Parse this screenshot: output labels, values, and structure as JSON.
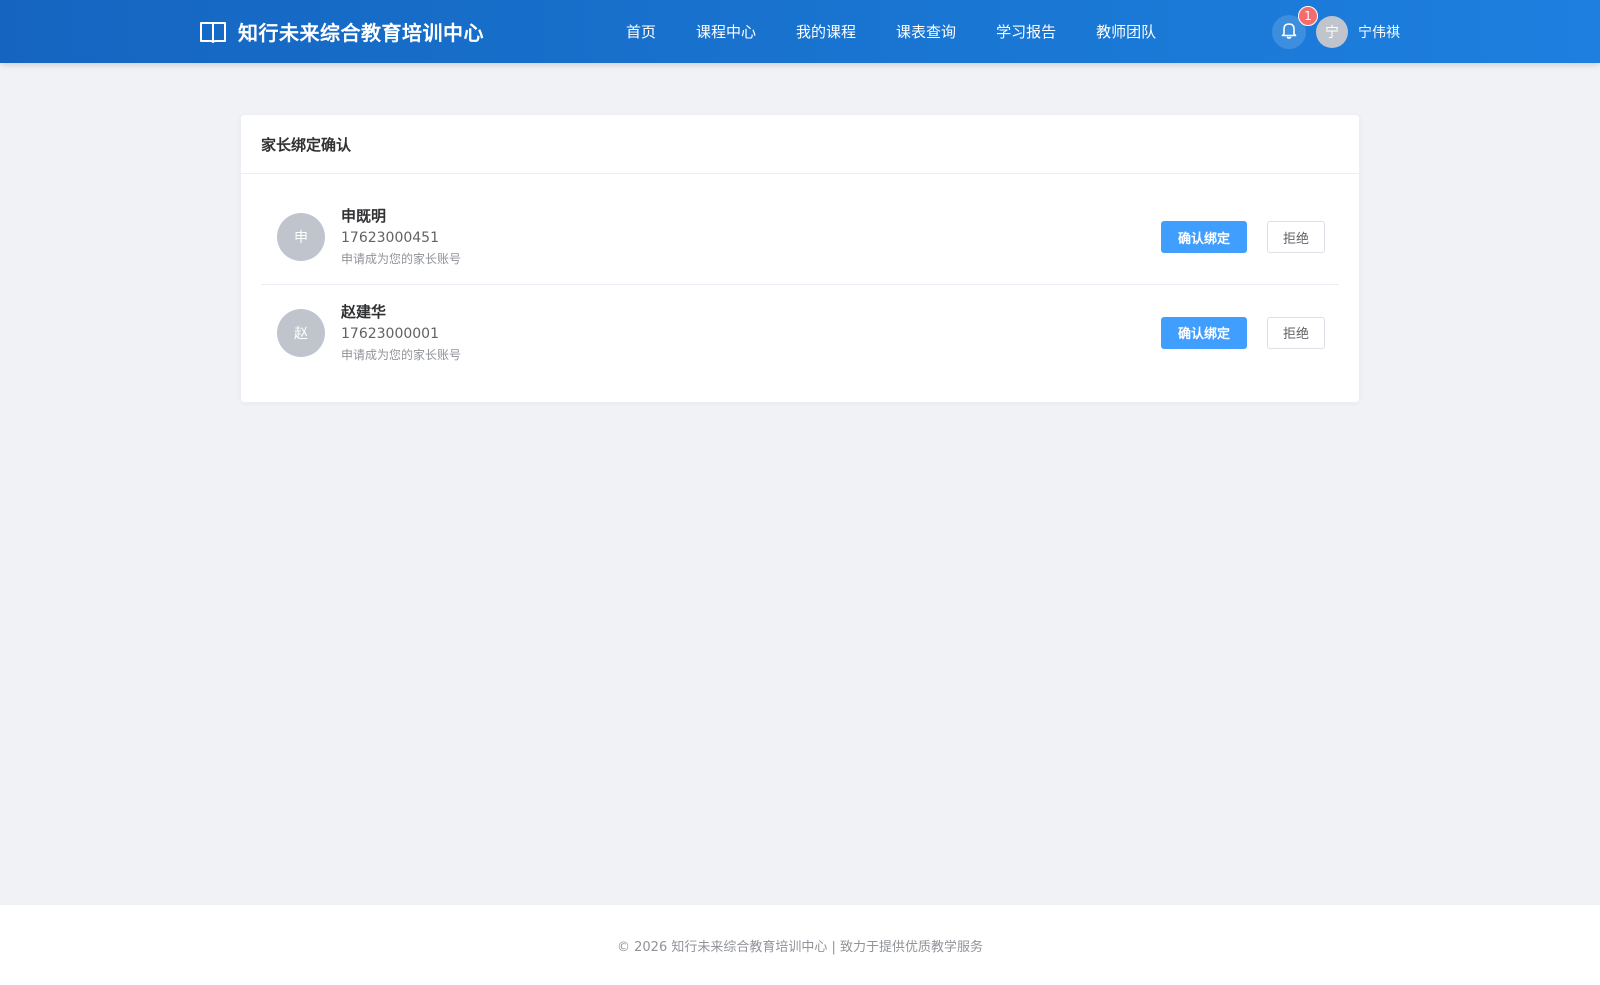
{
  "header": {
    "brand_title": "知行未来综合教育培训中心",
    "brand_icon": "book-open-icon",
    "nav": [
      {
        "label": "首页"
      },
      {
        "label": "课程中心"
      },
      {
        "label": "我的课程"
      },
      {
        "label": "课表查询"
      },
      {
        "label": "学习报告"
      },
      {
        "label": "教师团队"
      }
    ],
    "notification_count": "1",
    "user_avatar_char": "宁",
    "user_name": "宁伟祺"
  },
  "card": {
    "title": "家长绑定确认",
    "requests": [
      {
        "avatar_char": "申",
        "name": "申既明",
        "phone": "17623000451",
        "note": "申请成为您的家长账号",
        "confirm_label": "确认绑定",
        "reject_label": "拒绝"
      },
      {
        "avatar_char": "赵",
        "name": "赵建华",
        "phone": "17623000001",
        "note": "申请成为您的家长账号",
        "confirm_label": "确认绑定",
        "reject_label": "拒绝"
      }
    ]
  },
  "footer": {
    "text": "© 2026 知行未来综合教育培训中心 | 致力于提供优质教学服务"
  },
  "colors": {
    "header_bg": "#1976d2",
    "primary": "#409eff",
    "badge": "#f56c6c",
    "page_bg": "#f0f2f5"
  }
}
